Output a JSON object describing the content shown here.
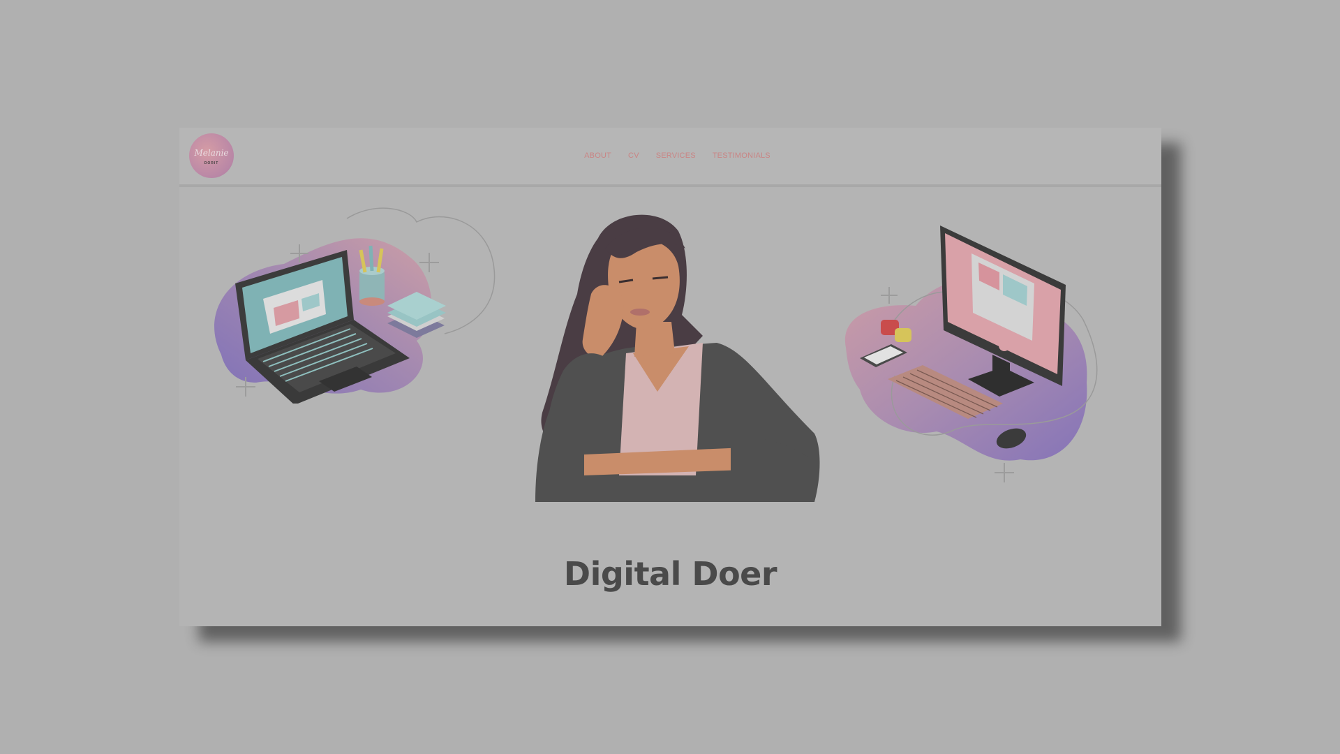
{
  "logo": {
    "script_text": "Melanie",
    "tagline": "DORIT"
  },
  "nav": {
    "items": [
      {
        "label": "ABOUT"
      },
      {
        "label": "CV"
      },
      {
        "label": "SERVICES"
      },
      {
        "label": "TESTIMONIALS"
      }
    ]
  },
  "hero": {
    "title": "Digital Doer"
  },
  "colors": {
    "page_background": "#b0b0b0",
    "site_background": "#b4b4b4",
    "nav_link": "#c98585",
    "title_text": "#4a4a4a",
    "blob_purple": "#8a78b6",
    "blob_pink": "#c99aa6"
  },
  "illustrations": {
    "left": "laptop-workspace-illustration",
    "center": "woman-thinking-illustration",
    "right": "desktop-computer-illustration"
  }
}
